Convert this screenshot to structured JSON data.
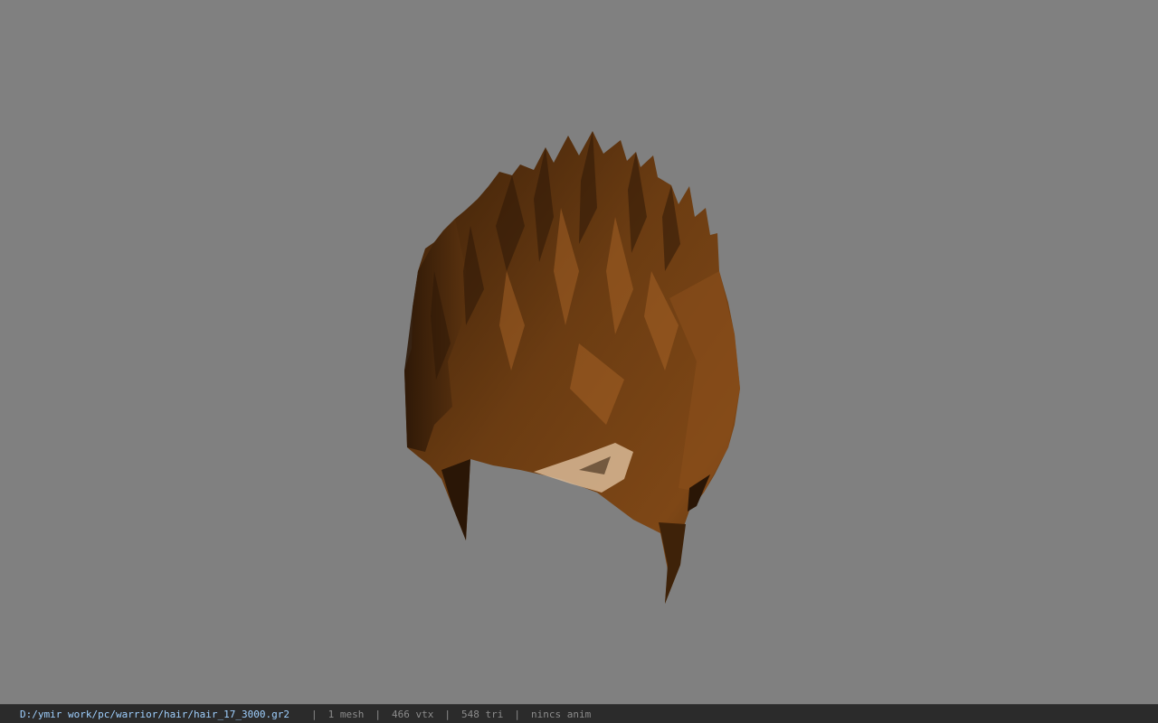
{
  "viewer": {
    "background_color": "#808080",
    "model_icon": "hair-mesh-3d",
    "model_colors": {
      "dark": "#2a1606",
      "mid": "#5a320f",
      "light": "#8a4e1a",
      "highlight": "#c98a4a",
      "skin": "#d8b895"
    }
  },
  "status": {
    "path": "D:/ymir work/pc/warrior/hair/hair_17_3000.gr2",
    "sep": "|",
    "mesh": "1 mesh",
    "vtx": "466 vtx",
    "tri": "548 tri",
    "anim": "nincs anim"
  }
}
